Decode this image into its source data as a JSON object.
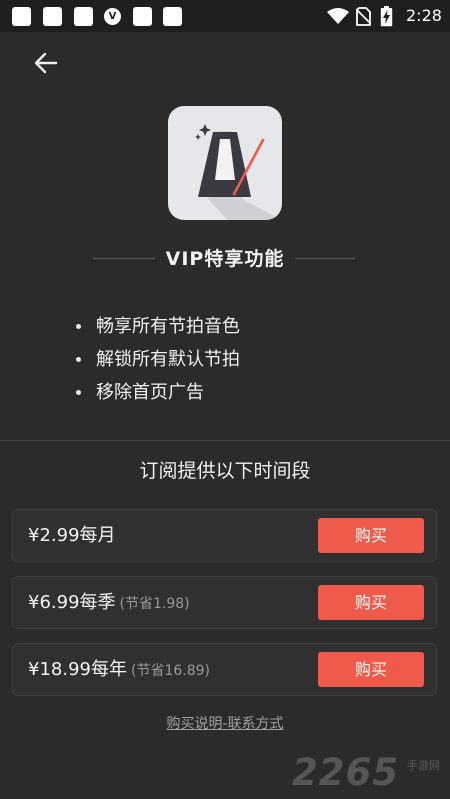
{
  "status_bar": {
    "time": "2:28",
    "shield_glyph": "V",
    "icons": [
      "notification-square-icon",
      "notification-square-icon",
      "notification-square-icon",
      "shield-icon",
      "notification-square-icon",
      "notification-square-icon",
      "wifi-icon",
      "no-sim-icon",
      "battery-charging-icon"
    ]
  },
  "header": {
    "back_icon": "arrow-left-icon"
  },
  "app": {
    "logo_icon": "metronome-icon"
  },
  "vip": {
    "title": "VIP特享功能",
    "features": [
      "畅享所有节拍音色",
      "解锁所有默认节拍",
      "移除首页广告"
    ]
  },
  "subscription": {
    "title": "订阅提供以下时间段",
    "plans": [
      {
        "price": "¥2.99每月",
        "save": "",
        "button_label": "购买"
      },
      {
        "price": "¥6.99每季",
        "save": "(节省1.98)",
        "button_label": "购买"
      },
      {
        "price": "¥18.99每年",
        "save": "(节省16.89)",
        "button_label": "购买"
      }
    ]
  },
  "footer": {
    "link": "购买说明-联系方式"
  },
  "watermark": {
    "number": "2265",
    "text": "手游网"
  },
  "colors": {
    "background": "#2b2b2b",
    "accent": "#f05a4a",
    "status_bar": "#1f1f1f"
  }
}
